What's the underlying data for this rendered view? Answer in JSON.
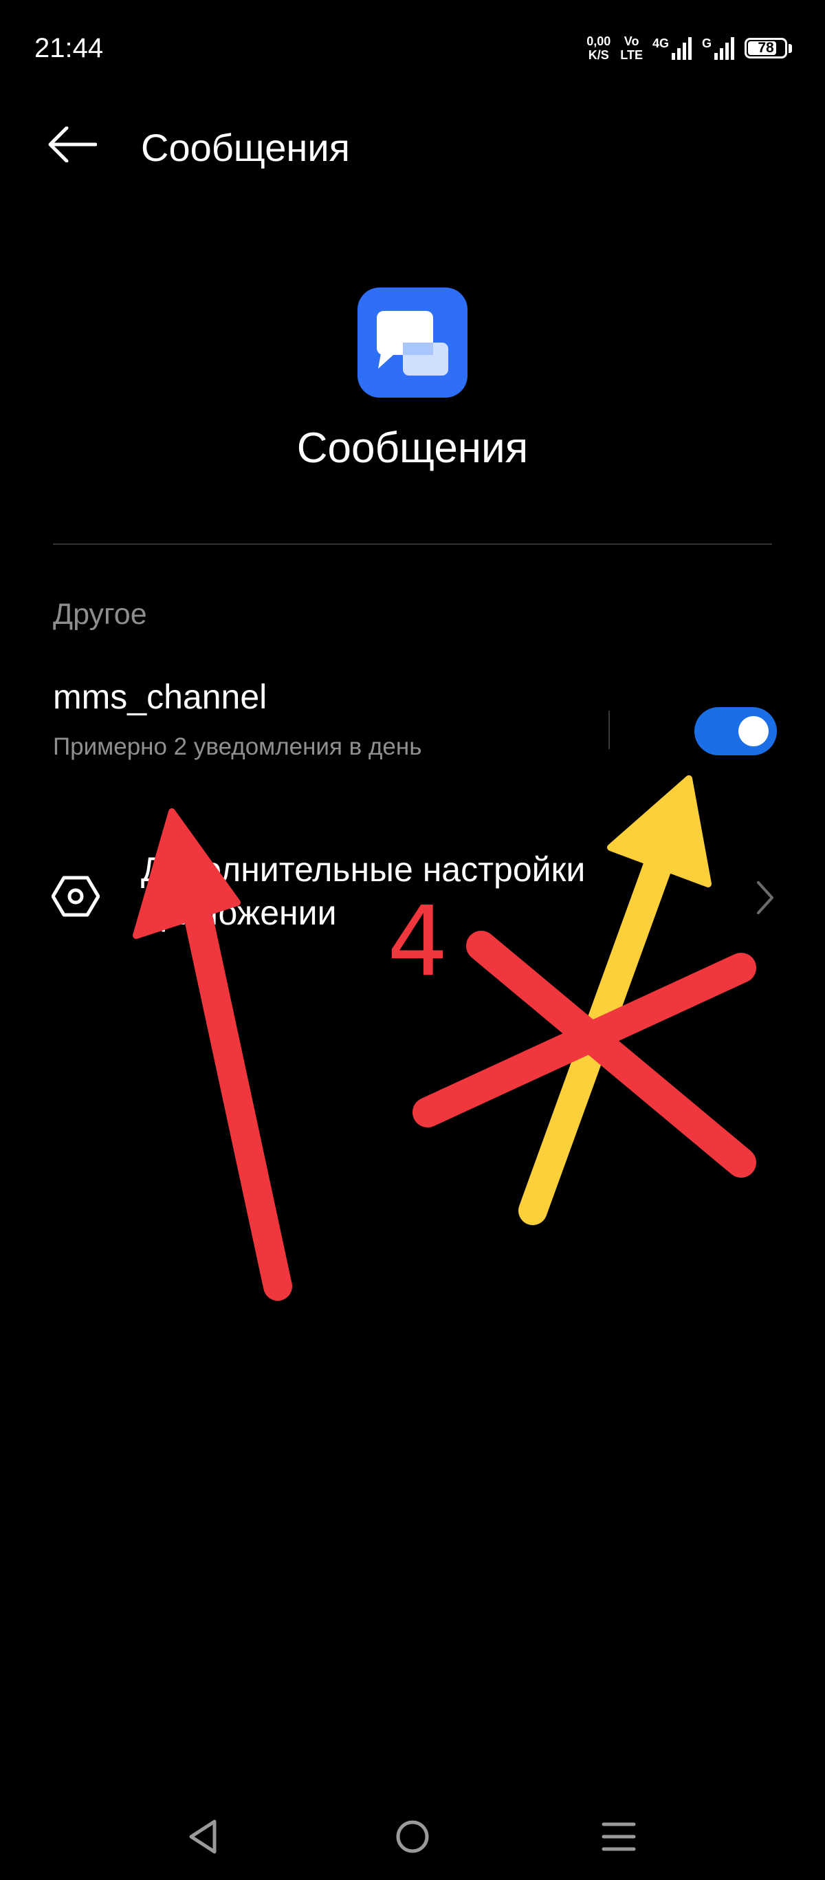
{
  "status_bar": {
    "time": "21:44",
    "net_speed_value": "0,00",
    "net_speed_unit": "K/S",
    "volte_top": "Vo",
    "volte_bottom": "LTE",
    "sim1_label": "4G",
    "sim2_label": "G",
    "battery_level": "78",
    "battery_fraction": 0.78
  },
  "header": {
    "back_icon": "arrow-left-icon",
    "title": "Сообщения"
  },
  "app": {
    "icon": "chat-bubbles-icon",
    "name": "Сообщения",
    "icon_color": "#2f6ff5"
  },
  "section": {
    "label": "Другое"
  },
  "channel": {
    "title": "mms_channel",
    "subtitle": "Примерно 2 уведомления в день",
    "enabled": true,
    "toggle_color": "#1a6ee6"
  },
  "advanced": {
    "icon": "hexagon-gear-icon",
    "label": "Дополнительные настройки приложении",
    "chevron": "chevron-right-icon"
  },
  "annotation": {
    "number": "4",
    "red_color": "#f0373d",
    "yellow_color": "#fcd03a"
  },
  "nav_bar": {
    "back": "triangle-back-icon",
    "home": "circle-home-icon",
    "menu": "three-lines-menu-icon"
  }
}
